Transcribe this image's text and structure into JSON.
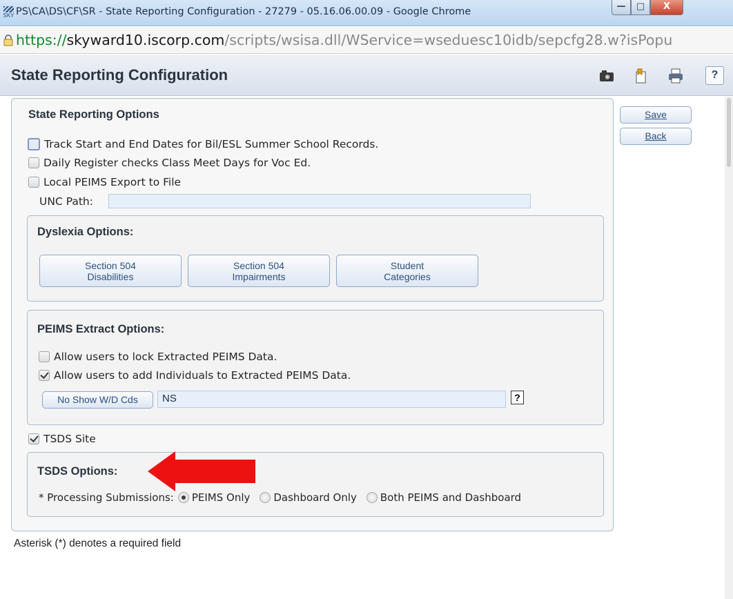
{
  "window": {
    "title": "PS\\CA\\DS\\CF\\SR - State Reporting Configuration - 27279 - 05.16.06.00.09 - Google Chrome",
    "logo_text": "SKY",
    "minimize": "—",
    "maximize": "□",
    "close": "X"
  },
  "address": {
    "scheme": "https://",
    "domain": "skyward10.iscorp.com",
    "path": "/scripts/wsisa.dll/WService=wseduesc10idb/sepcfg28.w?isPopu"
  },
  "header": {
    "title": "State Reporting Configuration",
    "help": "?"
  },
  "actions": {
    "save": "Save",
    "back": "Back"
  },
  "state_reporting": {
    "title": "State Reporting Options",
    "options": [
      {
        "label": "Track Start and End Dates for Bil/ESL Summer School Records.",
        "checked": false
      },
      {
        "label": "Daily Register checks Class Meet Days for Voc Ed.",
        "checked": false
      },
      {
        "label": "Local PEIMS Export to File",
        "checked": false
      }
    ],
    "unc_label": "UNC Path:",
    "unc_value": ""
  },
  "dyslexia": {
    "title": "Dyslexia Options:",
    "buttons": [
      {
        "line1": "Section 504",
        "line2": "Disabilities"
      },
      {
        "line1": "Section 504",
        "line2": "Impairments"
      },
      {
        "line1": "Student",
        "line2": "Categories"
      }
    ]
  },
  "peims": {
    "title": "PEIMS Extract Options:",
    "options": [
      {
        "label": "Allow users to lock Extracted PEIMS Data.",
        "checked": false
      },
      {
        "label": "Allow users to add Individuals to Extracted PEIMS Data.",
        "checked": true
      }
    ],
    "no_show_button": "No Show W/D Cds",
    "no_show_value": "NS",
    "help": "?"
  },
  "tsds": {
    "site_label": "TSDS Site",
    "site_checked": true,
    "title": "TSDS Options:",
    "processing_label": "* Processing Submissions:",
    "radio_options": [
      "PEIMS Only",
      "Dashboard Only",
      "Both PEIMS and Dashboard"
    ],
    "selected": "PEIMS Only"
  },
  "footer": {
    "note": "Asterisk (*) denotes a required field"
  },
  "colors": {
    "accent": "#2f4f7f",
    "input_bg": "#e7f0fa",
    "annotation_arrow": "#ee1111"
  },
  "icons": [
    "skyward-logo-icon",
    "lock-icon",
    "camera-icon",
    "bookmark-icon",
    "print-icon",
    "help-icon",
    "red-arrow-icon"
  ]
}
